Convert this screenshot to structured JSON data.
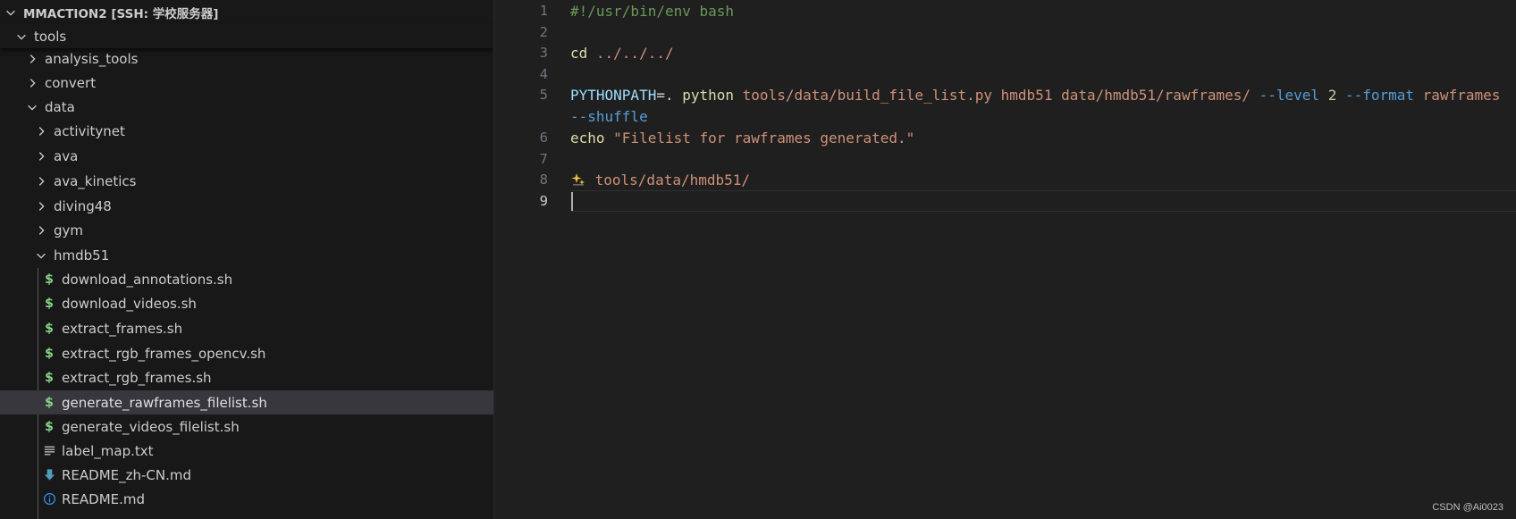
{
  "explorer": {
    "root_label": "MMACTION2 [SSH: 学校服务器]",
    "items": [
      {
        "label": "tools",
        "kind": "folder",
        "expanded": true
      },
      {
        "label": "analysis_tools",
        "kind": "folder",
        "expanded": false
      },
      {
        "label": "convert",
        "kind": "folder",
        "expanded": false
      },
      {
        "label": "data",
        "kind": "folder",
        "expanded": true
      },
      {
        "label": "activitynet",
        "kind": "folder",
        "expanded": false
      },
      {
        "label": "ava",
        "kind": "folder",
        "expanded": false
      },
      {
        "label": "ava_kinetics",
        "kind": "folder",
        "expanded": false
      },
      {
        "label": "diving48",
        "kind": "folder",
        "expanded": false
      },
      {
        "label": "gym",
        "kind": "folder",
        "expanded": false
      },
      {
        "label": "hmdb51",
        "kind": "folder",
        "expanded": true
      },
      {
        "label": "download_annotations.sh",
        "kind": "shell"
      },
      {
        "label": "download_videos.sh",
        "kind": "shell"
      },
      {
        "label": "extract_frames.sh",
        "kind": "shell"
      },
      {
        "label": "extract_rgb_frames_opencv.sh",
        "kind": "shell"
      },
      {
        "label": "extract_rgb_frames.sh",
        "kind": "shell"
      },
      {
        "label": "generate_rawframes_filelist.sh",
        "kind": "shell",
        "selected": true
      },
      {
        "label": "generate_videos_filelist.sh",
        "kind": "shell"
      },
      {
        "label": "label_map.txt",
        "kind": "text"
      },
      {
        "label": "README_zh-CN.md",
        "kind": "markdown-download"
      },
      {
        "label": "README.md",
        "kind": "markdown-info"
      }
    ]
  },
  "editor": {
    "active_line": "9",
    "line_numbers": [
      "1",
      "2",
      "3",
      "4",
      "5",
      "6",
      "7",
      "8",
      "9"
    ],
    "line1": {
      "shebang": "#!/usr/bin/env bash"
    },
    "line3": {
      "cmd": "cd",
      "arg": " ../../../"
    },
    "line5": {
      "var": "PYTHONPATH",
      "eq": "=. ",
      "cmd": "python",
      "script": " tools/data/build_file_list.py hmdb51 data/hmdb51/rawframes/",
      "flag_level": " --level",
      "level_val": " 2",
      "flag_format": " --format",
      "format_val": " rawframes",
      "flag_shuffle": "--shuffle"
    },
    "line6": {
      "cmd": "echo",
      "str": " \"Filelist for rawframes generated.\""
    },
    "line8": {
      "arg": " tools/data/hmdb51/"
    }
  },
  "watermark": "CSDN @Ai0023",
  "colors": {
    "sidebar_bg": "#181818",
    "editor_bg": "#1f1f1f",
    "selected_row": "#37373d",
    "shell_icon": "#89d185",
    "info_icon": "#3794ff"
  }
}
